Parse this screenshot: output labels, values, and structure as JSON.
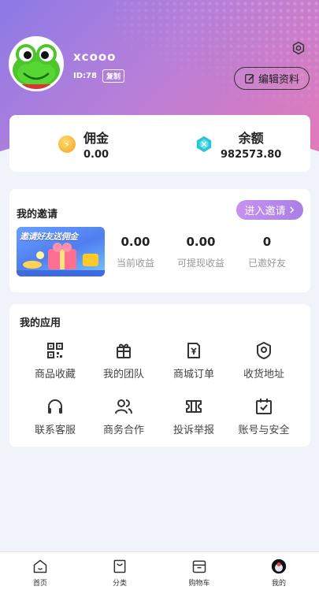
{
  "profile": {
    "username": "xcooo",
    "id_text": "ID:78",
    "copy_label": "复制",
    "edit_label": "编辑资料"
  },
  "wallet": {
    "commission_label": "佣金",
    "commission_value": "0.00",
    "balance_label": "余额",
    "balance_value": "982573.80"
  },
  "invite": {
    "title": "我的邀请",
    "button_label": "进入邀请",
    "banner_text": "邀请好友送佣金",
    "stats": [
      {
        "value": "0.00",
        "label": "当前收益"
      },
      {
        "value": "0.00",
        "label": "可提现收益"
      },
      {
        "value": "0",
        "label": "已邀好友"
      }
    ]
  },
  "apps": {
    "title": "我的应用",
    "items": [
      {
        "label": "商品收藏",
        "icon": "qrcode-icon"
      },
      {
        "label": "我的团队",
        "icon": "gift-icon"
      },
      {
        "label": "商城订单",
        "icon": "order-icon"
      },
      {
        "label": "收货地址",
        "icon": "location-icon"
      },
      {
        "label": "联系客服",
        "icon": "headset-icon"
      },
      {
        "label": "商务合作",
        "icon": "users-icon"
      },
      {
        "label": "投诉举报",
        "icon": "ticket-icon"
      },
      {
        "label": "账号与安全",
        "icon": "calendar-check-icon"
      }
    ]
  },
  "tabbar": {
    "items": [
      {
        "label": "首页",
        "icon": "home-icon"
      },
      {
        "label": "分类",
        "icon": "bag-icon"
      },
      {
        "label": "购物车",
        "icon": "cart-box-icon"
      },
      {
        "label": "我的",
        "icon": "avatar-icon"
      }
    ]
  },
  "colors": {
    "hero_gradient": [
      "#8c7ae6",
      "#e27ab8"
    ],
    "invite_button": "#b98aec",
    "page_bg": "#f1f3fa"
  }
}
